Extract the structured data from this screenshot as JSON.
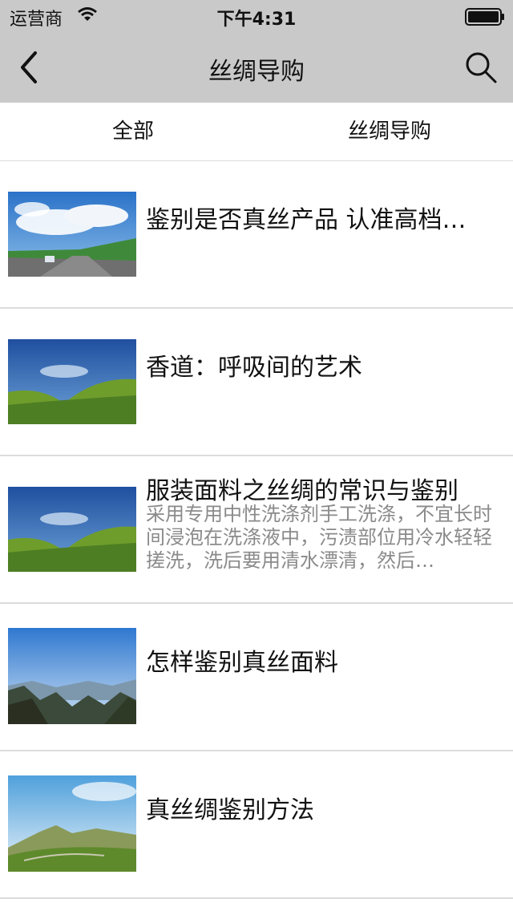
{
  "status_bar": {
    "carrier": "运营商",
    "time": "下午4:31"
  },
  "nav": {
    "title": "丝绸导购"
  },
  "tabs": [
    {
      "label": "全部"
    },
    {
      "label": "丝绸导购"
    }
  ],
  "articles": [
    {
      "title": "鉴别是否真丝产品 认准高档…",
      "summary": "",
      "thumb": "sky-road-photo"
    },
    {
      "title": "香道：呼吸间的艺术",
      "summary": "",
      "thumb": "green-hills-photo"
    },
    {
      "title": "服装面料之丝绸的常识与鉴别",
      "summary": "采用专用中性洗涤剂手工洗涤，不宜长时间浸泡在洗涤液中，污渍部位用冷水轻轻搓洗，洗后要用清水漂清，然后…",
      "thumb": "green-hills-photo"
    },
    {
      "title": "怎样鉴别真丝面料",
      "summary": "",
      "thumb": "mountain-valley-photo"
    },
    {
      "title": "真丝绸鉴别方法",
      "summary": "",
      "thumb": "grassland-hill-photo"
    }
  ]
}
